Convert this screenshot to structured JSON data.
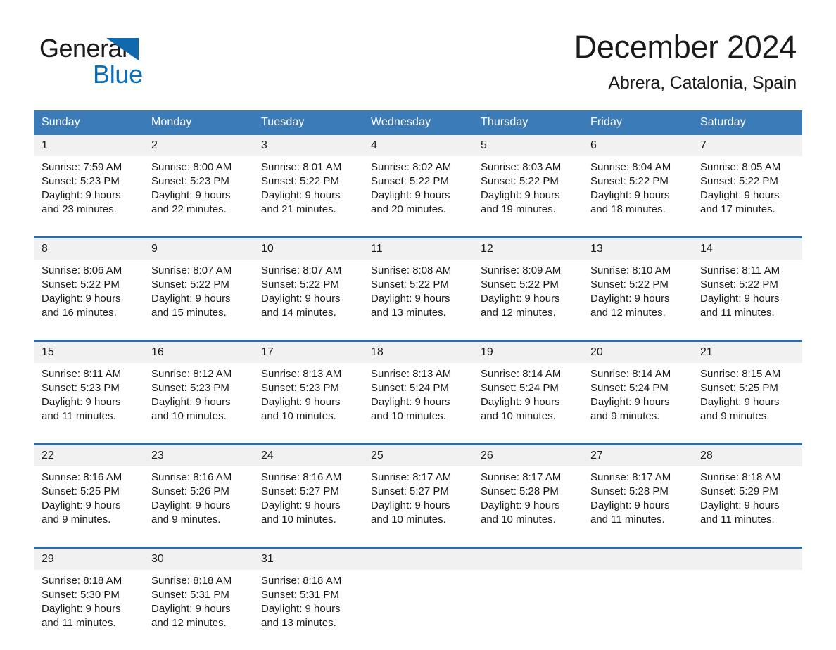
{
  "brand": {
    "word1": "General",
    "word2": "Blue",
    "triangle_color": "#1068ad",
    "blue_color": "#0a6ebd"
  },
  "header": {
    "title": "December 2024",
    "location": "Abrera, Catalonia, Spain"
  },
  "theme": {
    "header_bg": "#3b7cb8",
    "row_rule": "#2b6ca8",
    "daynum_bg": "#f1f1f1",
    "text": "#1a1a1a"
  },
  "weekdays": [
    "Sunday",
    "Monday",
    "Tuesday",
    "Wednesday",
    "Thursday",
    "Friday",
    "Saturday"
  ],
  "weeks": [
    [
      {
        "day": "1",
        "sunrise": "Sunrise: 7:59 AM",
        "sunset": "Sunset: 5:23 PM",
        "daylight1": "Daylight: 9 hours",
        "daylight2": "and 23 minutes."
      },
      {
        "day": "2",
        "sunrise": "Sunrise: 8:00 AM",
        "sunset": "Sunset: 5:23 PM",
        "daylight1": "Daylight: 9 hours",
        "daylight2": "and 22 minutes."
      },
      {
        "day": "3",
        "sunrise": "Sunrise: 8:01 AM",
        "sunset": "Sunset: 5:22 PM",
        "daylight1": "Daylight: 9 hours",
        "daylight2": "and 21 minutes."
      },
      {
        "day": "4",
        "sunrise": "Sunrise: 8:02 AM",
        "sunset": "Sunset: 5:22 PM",
        "daylight1": "Daylight: 9 hours",
        "daylight2": "and 20 minutes."
      },
      {
        "day": "5",
        "sunrise": "Sunrise: 8:03 AM",
        "sunset": "Sunset: 5:22 PM",
        "daylight1": "Daylight: 9 hours",
        "daylight2": "and 19 minutes."
      },
      {
        "day": "6",
        "sunrise": "Sunrise: 8:04 AM",
        "sunset": "Sunset: 5:22 PM",
        "daylight1": "Daylight: 9 hours",
        "daylight2": "and 18 minutes."
      },
      {
        "day": "7",
        "sunrise": "Sunrise: 8:05 AM",
        "sunset": "Sunset: 5:22 PM",
        "daylight1": "Daylight: 9 hours",
        "daylight2": "and 17 minutes."
      }
    ],
    [
      {
        "day": "8",
        "sunrise": "Sunrise: 8:06 AM",
        "sunset": "Sunset: 5:22 PM",
        "daylight1": "Daylight: 9 hours",
        "daylight2": "and 16 minutes."
      },
      {
        "day": "9",
        "sunrise": "Sunrise: 8:07 AM",
        "sunset": "Sunset: 5:22 PM",
        "daylight1": "Daylight: 9 hours",
        "daylight2": "and 15 minutes."
      },
      {
        "day": "10",
        "sunrise": "Sunrise: 8:07 AM",
        "sunset": "Sunset: 5:22 PM",
        "daylight1": "Daylight: 9 hours",
        "daylight2": "and 14 minutes."
      },
      {
        "day": "11",
        "sunrise": "Sunrise: 8:08 AM",
        "sunset": "Sunset: 5:22 PM",
        "daylight1": "Daylight: 9 hours",
        "daylight2": "and 13 minutes."
      },
      {
        "day": "12",
        "sunrise": "Sunrise: 8:09 AM",
        "sunset": "Sunset: 5:22 PM",
        "daylight1": "Daylight: 9 hours",
        "daylight2": "and 12 minutes."
      },
      {
        "day": "13",
        "sunrise": "Sunrise: 8:10 AM",
        "sunset": "Sunset: 5:22 PM",
        "daylight1": "Daylight: 9 hours",
        "daylight2": "and 12 minutes."
      },
      {
        "day": "14",
        "sunrise": "Sunrise: 8:11 AM",
        "sunset": "Sunset: 5:22 PM",
        "daylight1": "Daylight: 9 hours",
        "daylight2": "and 11 minutes."
      }
    ],
    [
      {
        "day": "15",
        "sunrise": "Sunrise: 8:11 AM",
        "sunset": "Sunset: 5:23 PM",
        "daylight1": "Daylight: 9 hours",
        "daylight2": "and 11 minutes."
      },
      {
        "day": "16",
        "sunrise": "Sunrise: 8:12 AM",
        "sunset": "Sunset: 5:23 PM",
        "daylight1": "Daylight: 9 hours",
        "daylight2": "and 10 minutes."
      },
      {
        "day": "17",
        "sunrise": "Sunrise: 8:13 AM",
        "sunset": "Sunset: 5:23 PM",
        "daylight1": "Daylight: 9 hours",
        "daylight2": "and 10 minutes."
      },
      {
        "day": "18",
        "sunrise": "Sunrise: 8:13 AM",
        "sunset": "Sunset: 5:24 PM",
        "daylight1": "Daylight: 9 hours",
        "daylight2": "and 10 minutes."
      },
      {
        "day": "19",
        "sunrise": "Sunrise: 8:14 AM",
        "sunset": "Sunset: 5:24 PM",
        "daylight1": "Daylight: 9 hours",
        "daylight2": "and 10 minutes."
      },
      {
        "day": "20",
        "sunrise": "Sunrise: 8:14 AM",
        "sunset": "Sunset: 5:24 PM",
        "daylight1": "Daylight: 9 hours",
        "daylight2": "and 9 minutes."
      },
      {
        "day": "21",
        "sunrise": "Sunrise: 8:15 AM",
        "sunset": "Sunset: 5:25 PM",
        "daylight1": "Daylight: 9 hours",
        "daylight2": "and 9 minutes."
      }
    ],
    [
      {
        "day": "22",
        "sunrise": "Sunrise: 8:16 AM",
        "sunset": "Sunset: 5:25 PM",
        "daylight1": "Daylight: 9 hours",
        "daylight2": "and 9 minutes."
      },
      {
        "day": "23",
        "sunrise": "Sunrise: 8:16 AM",
        "sunset": "Sunset: 5:26 PM",
        "daylight1": "Daylight: 9 hours",
        "daylight2": "and 9 minutes."
      },
      {
        "day": "24",
        "sunrise": "Sunrise: 8:16 AM",
        "sunset": "Sunset: 5:27 PM",
        "daylight1": "Daylight: 9 hours",
        "daylight2": "and 10 minutes."
      },
      {
        "day": "25",
        "sunrise": "Sunrise: 8:17 AM",
        "sunset": "Sunset: 5:27 PM",
        "daylight1": "Daylight: 9 hours",
        "daylight2": "and 10 minutes."
      },
      {
        "day": "26",
        "sunrise": "Sunrise: 8:17 AM",
        "sunset": "Sunset: 5:28 PM",
        "daylight1": "Daylight: 9 hours",
        "daylight2": "and 10 minutes."
      },
      {
        "day": "27",
        "sunrise": "Sunrise: 8:17 AM",
        "sunset": "Sunset: 5:28 PM",
        "daylight1": "Daylight: 9 hours",
        "daylight2": "and 11 minutes."
      },
      {
        "day": "28",
        "sunrise": "Sunrise: 8:18 AM",
        "sunset": "Sunset: 5:29 PM",
        "daylight1": "Daylight: 9 hours",
        "daylight2": "and 11 minutes."
      }
    ],
    [
      {
        "day": "29",
        "sunrise": "Sunrise: 8:18 AM",
        "sunset": "Sunset: 5:30 PM",
        "daylight1": "Daylight: 9 hours",
        "daylight2": "and 11 minutes."
      },
      {
        "day": "30",
        "sunrise": "Sunrise: 8:18 AM",
        "sunset": "Sunset: 5:31 PM",
        "daylight1": "Daylight: 9 hours",
        "daylight2": "and 12 minutes."
      },
      {
        "day": "31",
        "sunrise": "Sunrise: 8:18 AM",
        "sunset": "Sunset: 5:31 PM",
        "daylight1": "Daylight: 9 hours",
        "daylight2": "and 13 minutes."
      },
      {
        "day": "",
        "sunrise": "",
        "sunset": "",
        "daylight1": "",
        "daylight2": ""
      },
      {
        "day": "",
        "sunrise": "",
        "sunset": "",
        "daylight1": "",
        "daylight2": ""
      },
      {
        "day": "",
        "sunrise": "",
        "sunset": "",
        "daylight1": "",
        "daylight2": ""
      },
      {
        "day": "",
        "sunrise": "",
        "sunset": "",
        "daylight1": "",
        "daylight2": ""
      }
    ]
  ]
}
